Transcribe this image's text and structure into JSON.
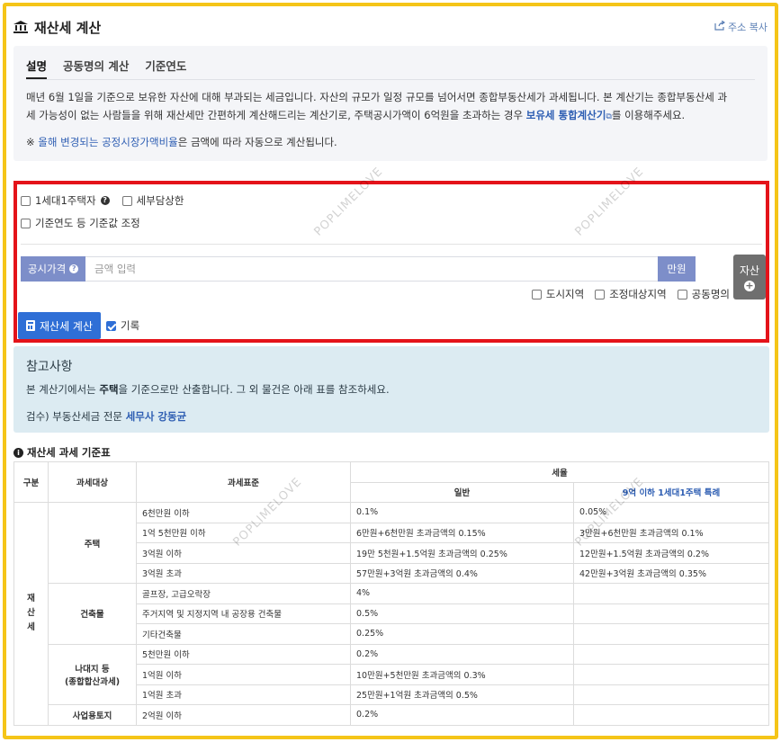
{
  "header": {
    "title": "재산세 계산",
    "copy_label": "주소 복사"
  },
  "tabs": [
    {
      "label": "설명"
    },
    {
      "label": "공동명의 계산"
    },
    {
      "label": "기준연도"
    }
  ],
  "description": {
    "line1": "매년 6월 1일을 기준으로 보유한 자산에 대해 부과되는 세금입니다. 자산의 규모가 일정 규모를 넘어서면 종합부동산세가 과세됩니다. 본 계산기는 종합부동산세 과",
    "line2_pre": "세 가능성이 없는 사람들을 위해 재산세만 간편하게 계산해드리는 계산기로, 주택공시가액이 6억원을 초과하는 경우 ",
    "line2_link": "보유세 통합계산기",
    "line2_post": "를 이용해주세요.",
    "note_prefix": "※ ",
    "note_link": "올해 변경되는 공정시장가액비율",
    "note_post": "은 금액에 따라 자동으로 계산됩니다."
  },
  "options": {
    "single_house": "1세대1주택자",
    "tax_cap": "세부담상한",
    "base_adjust": "기준연도 등 기준값 조정"
  },
  "price": {
    "label": "공시가격",
    "placeholder": "금액 입력",
    "unit": "만원",
    "asset_button": "자산"
  },
  "regions": {
    "urban": "도시지역",
    "adjusted": "조정대상지역",
    "joint": "공동명의"
  },
  "calc": {
    "button": "재산세 계산",
    "record_label": "기록"
  },
  "reference": {
    "title": "참고사항",
    "text_pre": "본 계산기에서는 ",
    "text_bold": "주택",
    "text_post": "을 기준으로만 산출합니다. 그 외 물건은 아래 표를 참조하세요.",
    "sign_pre": "검수) 부동산세금 전문 ",
    "sign_link": "세무사 강동균"
  },
  "table": {
    "title": "재산세 과세 기준표",
    "headers": {
      "category": "구분",
      "target": "과세대상",
      "standard": "과세표준",
      "rate": "세율",
      "general": "일반",
      "special": "9억 이하 1세대1주택 특례"
    },
    "category_label": "재\n산\n세",
    "groups": [
      {
        "name": "주택",
        "rows": [
          {
            "standard": "6천만원 이하",
            "general": "0.1%",
            "special": "0.05%"
          },
          {
            "standard": "1억 5천만원 이하",
            "general": "6만원+6천만원 초과금액의 0.15%",
            "special": "3만원+6천만원 초과금액의 0.1%"
          },
          {
            "standard": "3억원 이하",
            "general": "19만 5천원+1.5억원 초과금액의 0.25%",
            "special": "12만원+1.5억원 초과금액의 0.2%"
          },
          {
            "standard": "3억원 초과",
            "general": "57만원+3억원 초과금액의 0.4%",
            "special": "42만원+3억원 초과금액의 0.35%"
          }
        ]
      },
      {
        "name": "건축물",
        "rows": [
          {
            "standard": "골프장, 고급오락장",
            "general": "4%",
            "special": ""
          },
          {
            "standard": "주거지역 및 지정지역 내 공장용 건축물",
            "general": "0.5%",
            "special": ""
          },
          {
            "standard": "기타건축물",
            "general": "0.25%",
            "special": ""
          }
        ]
      },
      {
        "name": "나대지 등\n(종합합산과세)",
        "rows": [
          {
            "standard": "5천만원 이하",
            "general": "0.2%",
            "special": ""
          },
          {
            "standard": "1억원 이하",
            "general": "10만원+5천만원 초과금액의 0.3%",
            "special": ""
          },
          {
            "standard": "1억원 초과",
            "general": "25만원+1억원 초과금액의 0.5%",
            "special": ""
          }
        ]
      },
      {
        "name": "사업용토지",
        "rows": [
          {
            "standard": "2억원 이하",
            "general": "0.2%",
            "special": ""
          }
        ]
      }
    ]
  },
  "watermark": "POPLIMELOVE",
  "colors": {
    "frame": "#f5c518",
    "highlight": "#e4131a",
    "accent": "#2f6fd6",
    "label_bg": "#7d8ec9",
    "link": "#2f5fb3"
  }
}
